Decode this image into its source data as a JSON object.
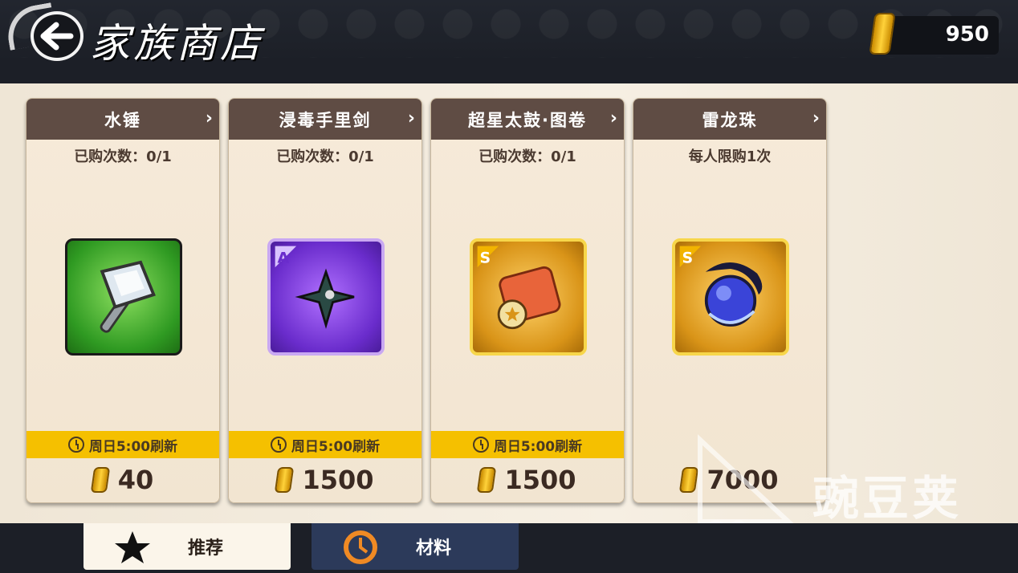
{
  "header": {
    "title": "家族商店",
    "currency_amount": "950"
  },
  "items": [
    {
      "name": "水锤",
      "limit": "已购次数：0/1",
      "refresh": "周日5:00刷新",
      "price": "40",
      "icon": "hammer-icon",
      "rarity": "",
      "bg": "#3aa82c"
    },
    {
      "name": "浸毒手里剑",
      "limit": "已购次数：0/1",
      "refresh": "周日5:00刷新",
      "price": "1500",
      "icon": "shuriken-icon",
      "rarity": "A",
      "bg": "#7b3fd6"
    },
    {
      "name": "超星太鼓·图卷",
      "limit": "已购次数：0/1",
      "refresh": "周日5:00刷新",
      "price": "1500",
      "icon": "scroll-icon",
      "rarity": "S",
      "bg": "#e0a020"
    },
    {
      "name": "雷龙珠",
      "limit": "每人限购1次",
      "refresh": "",
      "price": "7000",
      "icon": "orb-icon",
      "rarity": "S",
      "bg": "#e0a020"
    }
  ],
  "tabs": [
    {
      "label": "推荐",
      "active": true
    },
    {
      "label": "材料",
      "active": false
    }
  ],
  "watermark": "豌豆荚"
}
